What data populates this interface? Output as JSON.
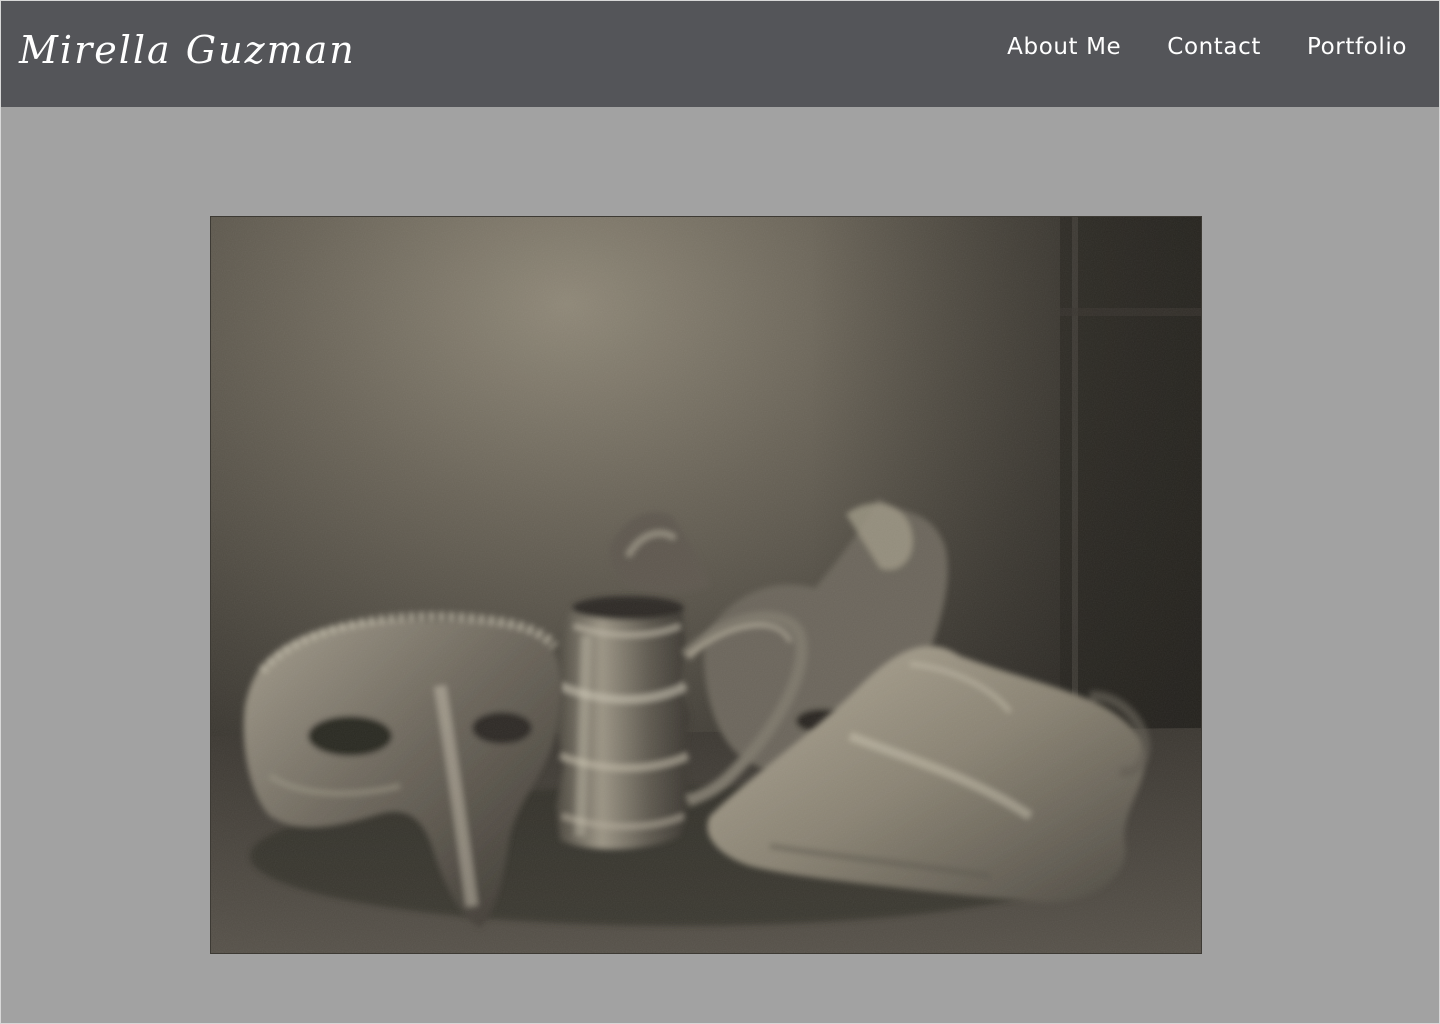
{
  "header": {
    "brand_name": "Mirella Guzman",
    "nav": [
      {
        "label": "About Me"
      },
      {
        "label": "Contact"
      },
      {
        "label": "Portfolio"
      }
    ]
  },
  "colors": {
    "header_background": "#545559",
    "page_background": "#a2a2a2",
    "text": "#ffffff"
  }
}
